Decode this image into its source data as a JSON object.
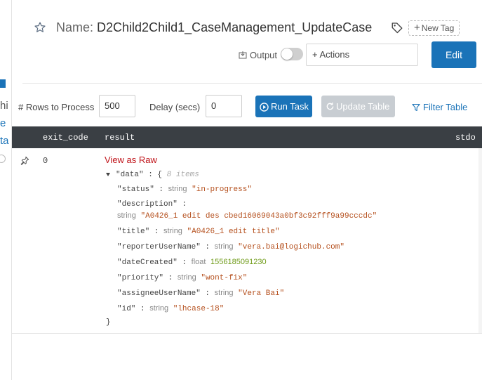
{
  "sidebar": {
    "fragments": [
      "hi",
      "e",
      "ta"
    ]
  },
  "header": {
    "name_label": "Name:",
    "name_value": "D2Child2Child1_CaseManagement_UpdateCase",
    "new_tag_label": "New Tag",
    "output_label": "Output",
    "output_enabled": false,
    "actions_label": "+ Actions",
    "edit_label": "Edit"
  },
  "controls": {
    "rows_label": "# Rows to Process",
    "rows_value": "500",
    "delay_label": "Delay (secs)",
    "delay_value": "0",
    "run_label": "Run Task",
    "update_label": "Update Table",
    "filter_label": "Filter Table"
  },
  "table": {
    "columns": [
      "exit_code",
      "result",
      "stdo"
    ],
    "row": {
      "exit_code": "0",
      "view_raw_label": "View as Raw",
      "root_key": "\"data\"",
      "item_count": "8 items",
      "fields": [
        {
          "key": "\"status\"",
          "type": "string",
          "value": "\"in-progress\""
        },
        {
          "key": "\"description\"",
          "type": "string",
          "value": "\"A0426_1 edit des cbed16069043a0bf3c92fff9a99cccdc\""
        },
        {
          "key": "\"title\"",
          "type": "string",
          "value": "\"A0426_1 edit title\""
        },
        {
          "key": "\"reporterUserName\"",
          "type": "string",
          "value": "\"vera.bai@logichub.com\""
        },
        {
          "key": "\"dateCreated\"",
          "type": "float",
          "value": "1556185091230"
        },
        {
          "key": "\"priority\"",
          "type": "string",
          "value": "\"wont-fix\""
        },
        {
          "key": "\"assigneeUserName\"",
          "type": "string",
          "value": "\"Vera Bai\""
        },
        {
          "key": "\"id\"",
          "type": "string",
          "value": "\"lhcase-18\""
        }
      ]
    }
  },
  "colors": {
    "primary": "#1a73b8",
    "header_bg": "#3a3f44",
    "link_red": "#c0151b",
    "string_value": "#b5501e",
    "number_value": "#6e9a17"
  }
}
